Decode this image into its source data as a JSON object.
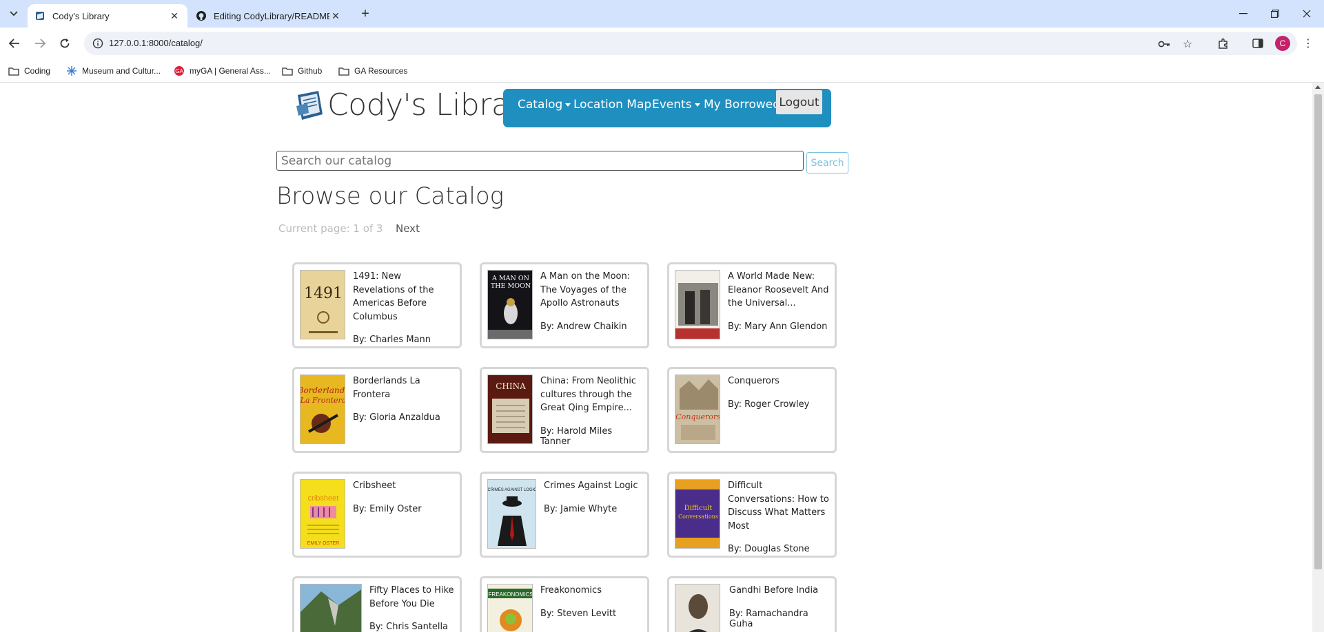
{
  "browser": {
    "tabs": [
      {
        "title": "Cody's Library",
        "active": true
      },
      {
        "title": "Editing CodyLibrary/README.m",
        "active": false
      }
    ],
    "address": "127.0.0.1:8000/catalog/",
    "bookmarks": [
      {
        "label": "Coding",
        "icon": "folder-icon"
      },
      {
        "label": "Museum and Cultur...",
        "icon": "snowflake-icon"
      },
      {
        "label": "myGA | General Ass...",
        "icon": "ga-icon"
      },
      {
        "label": "Github",
        "icon": "folder-icon"
      },
      {
        "label": "GA Resources",
        "icon": "folder-icon"
      }
    ],
    "profile_initial": "C"
  },
  "site": {
    "title": "Cody's Library",
    "nav": {
      "catalog": "Catalog",
      "location_map": "Location Map",
      "events": "Events",
      "my_borrowed": "My Borrowed",
      "logout": "Logout"
    },
    "accent_color": "#1f8fc0"
  },
  "search": {
    "placeholder": "Search our catalog",
    "button": "Search"
  },
  "catalog": {
    "heading": "Browse our Catalog",
    "current_page": "Current page: 1 of 3",
    "next": "Next",
    "books": [
      {
        "title": "1491: New Revelations of the Americas Before Columbus",
        "author": "By: Charles Mann"
      },
      {
        "title": "A Man on the Moon: The Voyages of the Apollo Astronauts",
        "author": "By: Andrew Chaikin"
      },
      {
        "title": "A World Made New: Eleanor Roosevelt And the Universal...",
        "author": "By: Mary Ann Glendon"
      },
      {
        "title": "Borderlands La Frontera",
        "author": "By: Gloria Anzaldua"
      },
      {
        "title": "China: From Neolithic cultures through the Great Qing Empire...",
        "author": "By: Harold Miles Tanner"
      },
      {
        "title": "Conquerors",
        "author": "By: Roger Crowley"
      },
      {
        "title": "Cribsheet",
        "author": "By: Emily Oster"
      },
      {
        "title": "Crimes Against Logic",
        "author": "By: Jamie Whyte"
      },
      {
        "title": "Difficult Conversations: How to Discuss What Matters Most",
        "author": "By: Douglas Stone"
      },
      {
        "title": "Fifty Places to Hike Before You Die",
        "author": "By: Chris Santella"
      },
      {
        "title": "Freakonomics",
        "author": "By: Steven Levitt"
      },
      {
        "title": "Gandhi Before India",
        "author": "By: Ramachandra Guha"
      }
    ]
  }
}
